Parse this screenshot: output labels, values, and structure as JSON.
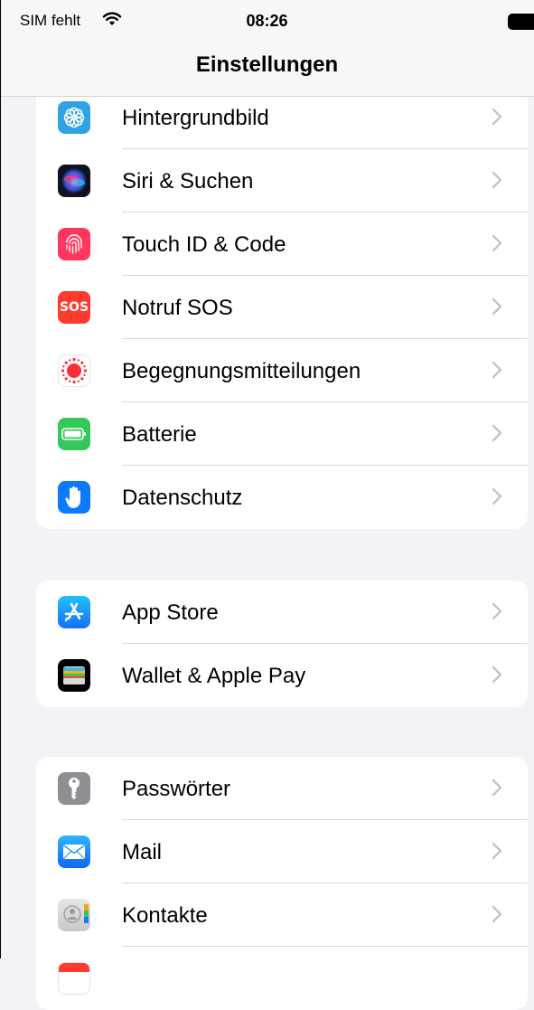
{
  "status_bar": {
    "carrier": "SIM fehlt",
    "time": "08:26"
  },
  "nav": {
    "title": "Einstellungen"
  },
  "groups": [
    {
      "rows": [
        {
          "label": "Hintergrundbild",
          "icon": "wallpaper-icon",
          "color": "#2fa3e6"
        },
        {
          "label": "Siri & Suchen",
          "icon": "siri-icon",
          "color": "#1b1b2e"
        },
        {
          "label": "Touch ID & Code",
          "icon": "fingerprint-icon",
          "color": "#ff375f"
        },
        {
          "label": "Notruf SOS",
          "icon": "sos-icon",
          "color": "#ff3b30",
          "icon_text": "SOS"
        },
        {
          "label": "Begegnungsmitteilungen",
          "icon": "exposure-icon",
          "color": "#ffffff"
        },
        {
          "label": "Batterie",
          "icon": "battery-icon",
          "color": "#34c759"
        },
        {
          "label": "Datenschutz",
          "icon": "hand-icon",
          "color": "#0a7aff"
        }
      ]
    },
    {
      "rows": [
        {
          "label": "App Store",
          "icon": "app-store-icon",
          "color": "#1c8ef9"
        },
        {
          "label": "Wallet & Apple Pay",
          "icon": "wallet-icon",
          "color": "#000000"
        }
      ]
    },
    {
      "rows": [
        {
          "label": "Passwörter",
          "icon": "key-icon",
          "color": "#8e8e93"
        },
        {
          "label": "Mail",
          "icon": "mail-icon",
          "color": "#1a8cff"
        },
        {
          "label": "Kontakte",
          "icon": "contacts-icon",
          "color": "#d6d6d6"
        },
        {
          "label": "",
          "icon": "calendar-icon",
          "color": "#ffffff"
        }
      ]
    }
  ]
}
